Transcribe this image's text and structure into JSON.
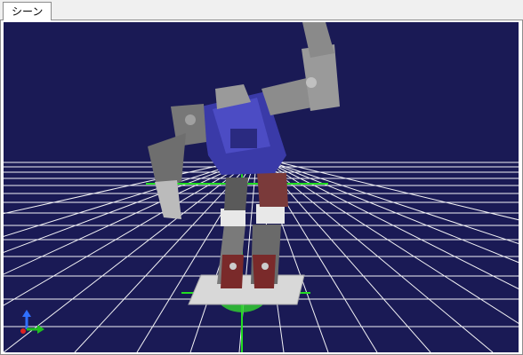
{
  "window": {
    "tab_label": "シーン"
  },
  "scene": {
    "background_color": "#1a1a55",
    "floor_grid_color": "#ffffff",
    "selection_axis_color": "#22dd22",
    "robot_body_color": "#3a3aa8",
    "robot_limb_color": "#8c8c8c",
    "robot_foot_joint_color": "#7a2a2a",
    "axis_indicator": {
      "x_color": "#e02020",
      "y_color": "#20c020",
      "z_color": "#3070ff"
    }
  }
}
